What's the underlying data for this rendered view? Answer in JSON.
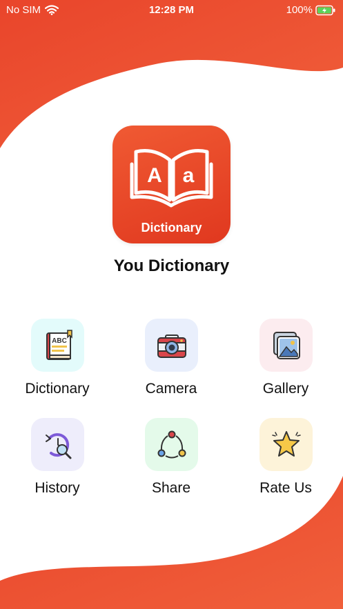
{
  "status_bar": {
    "carrier": "No SIM",
    "time": "12:28 PM",
    "battery": "100%"
  },
  "logo": {
    "letter_a_upper": "A",
    "letter_a_lower": "a",
    "brand_text": "Dictionary"
  },
  "app_title": "You Dictionary",
  "colors": {
    "accent": "#e8432a",
    "accent_light": "#f05a33",
    "text": "#111111"
  },
  "menu": [
    {
      "label": "Dictionary",
      "icon": "dictionary-book-icon",
      "icon_text": "ABC",
      "tile_color": "#e3fbfb"
    },
    {
      "label": "Camera",
      "icon": "camera-icon",
      "tile_color": "#e9effc"
    },
    {
      "label": "Gallery",
      "icon": "gallery-image-icon",
      "tile_color": "#fcecef"
    },
    {
      "label": "History",
      "icon": "history-search-icon",
      "tile_color": "#eeedfb"
    },
    {
      "label": "Share",
      "icon": "share-nodes-icon",
      "tile_color": "#e4faea"
    },
    {
      "label": "Rate Us",
      "icon": "star-icon",
      "tile_color": "#fdf3d9"
    }
  ]
}
